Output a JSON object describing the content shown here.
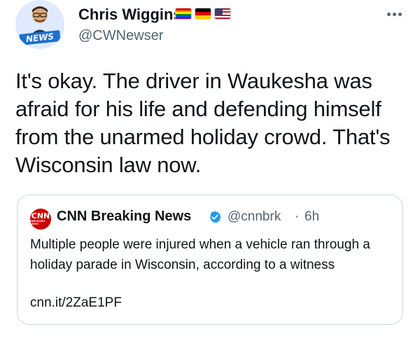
{
  "author": {
    "name": "Chris Wiggins",
    "handle": "@CWNewser",
    "avatar_badge": "NEWS",
    "flags": [
      "rainbow-flag",
      "germany-flag",
      "usa-flag"
    ]
  },
  "tweet": {
    "text": "It's okay. The driver in Waukesha was afraid for his life and defending himself from the unarmed holiday crowd. That's Wisconsin law now."
  },
  "more_menu": {
    "icon": "more-dots-icon"
  },
  "quote": {
    "logo_text": "CNN",
    "logo_subtext": "BREAKING NEWS",
    "name": "CNN Breaking News",
    "verified_icon": "verified-badge-icon",
    "handle": "@cnnbrk",
    "separator": "·",
    "time": "6h",
    "text": "Multiple people were injured when a vehicle ran through a holiday parade in Wisconsin, according to a witness",
    "link": "cnn.it/2ZaE1PF"
  },
  "colors": {
    "text_primary": "#0f1419",
    "text_secondary": "#536471",
    "border": "#cfd9de",
    "verified": "#1d9bf0",
    "cnn_red": "#cc0000"
  }
}
